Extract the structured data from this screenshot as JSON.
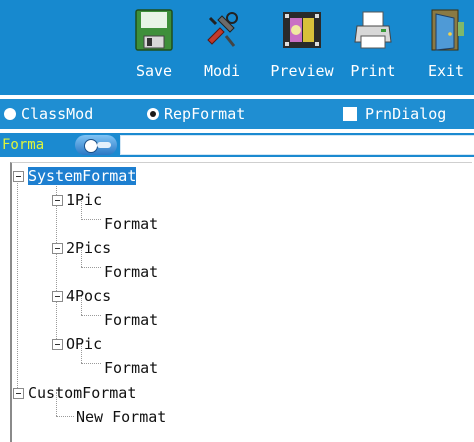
{
  "toolbar": {
    "buttons": [
      {
        "id": "save",
        "label": "Save",
        "icon": "save-icon"
      },
      {
        "id": "modi",
        "label": "Modi",
        "icon": "modify-icon"
      },
      {
        "id": "preview",
        "label": "Preview",
        "icon": "preview-icon"
      },
      {
        "id": "print",
        "label": "Print",
        "icon": "printer-icon"
      },
      {
        "id": "exit",
        "label": "Exit",
        "icon": "exit-door-icon"
      }
    ],
    "background": "#1789cf"
  },
  "options": {
    "class_mode_label": "ClassMod",
    "rep_format_label": "RepFormat",
    "selected": "RepFormat",
    "prn_dialog_label": "PrnDialog",
    "prn_dialog_checked": false
  },
  "format_row": {
    "label": "Forma",
    "value": "",
    "label_color": "#dff53b"
  },
  "tree": {
    "selected": "SystemFormat",
    "nodes": [
      {
        "label": "SystemFormat",
        "depth": 0
      },
      {
        "label": "1Pic",
        "depth": 1
      },
      {
        "label": "Format",
        "depth": 2
      },
      {
        "label": "2Pics",
        "depth": 1
      },
      {
        "label": "Format",
        "depth": 2
      },
      {
        "label": "4Pocs",
        "depth": 1
      },
      {
        "label": "Format",
        "depth": 2
      },
      {
        "label": "OPic",
        "depth": 1
      },
      {
        "label": "Format",
        "depth": 2
      },
      {
        "label": "CustomFormat",
        "depth": 0
      },
      {
        "label": "New Format",
        "depth": 1
      }
    ]
  },
  "colors": {
    "toolbar_blue": "#1789cf",
    "selection_blue": "#1d7fd0"
  }
}
